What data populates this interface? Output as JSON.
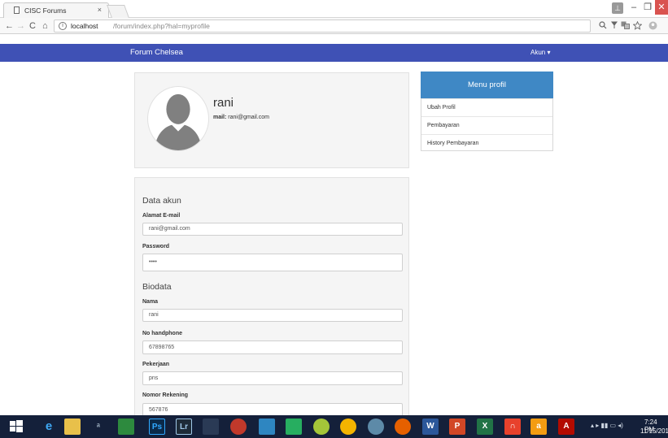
{
  "browser": {
    "tab_title": "CISC Forums",
    "tab_close": "×",
    "url_host": "localhost",
    "url_path": "/forum/index.php?hal=myprofile",
    "info_glyph": "i",
    "window_user_glyph": "⊥",
    "minimize_glyph": "–",
    "maximize_glyph": "❐",
    "close_glyph": "✕",
    "back_glyph": "←",
    "forward_glyph": "→",
    "reload_glyph": "C",
    "home_glyph": "⌂",
    "ext_icons": [
      "search-zoom-icon",
      "extension-icon",
      "translate-icon",
      "star-icon",
      "profile-icon"
    ]
  },
  "navbar": {
    "brand": "Forum Chelsea",
    "account": "Akun ▾",
    "color": "#3f51b5"
  },
  "profile": {
    "name": "rani",
    "mail_label": "mail:",
    "mail_value": "rani@gmail.com"
  },
  "menu": {
    "title": "Menu profil",
    "color": "#3f88c5",
    "items": [
      "Ubah Profil",
      "Pembayaran",
      "History Pembayaran"
    ]
  },
  "form": {
    "account_section": "Data akun",
    "email_label": "Alamat E-mail",
    "email_value": "rani@gmail.com",
    "password_label": "Password",
    "password_value": "••••",
    "bio_section": "Biodata",
    "name_label": "Nama",
    "name_value": "rani",
    "phone_label": "No handphone",
    "phone_value": "67898765",
    "job_label": "Pekerjaan",
    "job_value": "pns",
    "account_no_label": "Nomor Rekening",
    "account_no_value": "567876"
  },
  "taskbar": {
    "tray_glyphs": "▴ ▸ ▮▮ ▭ ◂)",
    "time": "7:24 PM",
    "date": "11/15/201"
  }
}
